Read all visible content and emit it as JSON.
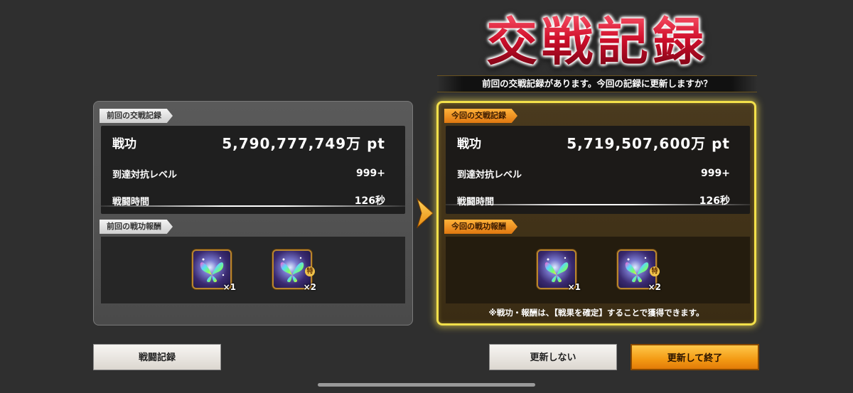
{
  "header": {
    "title": "交戦記録",
    "subtitle": "前回の交戦記録があります。今回の記録に更新しますか？"
  },
  "previous": {
    "record_label": "前回の交戦記録",
    "merit_label": "戦功",
    "merit_value": "5,790,777,749万 pt",
    "level_label": "到達対抗レベル",
    "level_value": "999+",
    "time_label": "戦闘時間",
    "time_value": "126秒",
    "reward_label": "前回の戦功報酬",
    "rewards": [
      {
        "icon": "rainbow-butterfly-icon",
        "qty": "×1",
        "special": ""
      },
      {
        "icon": "rainbow-butterfly-icon",
        "qty": "×2",
        "special": "特"
      }
    ]
  },
  "current": {
    "record_label": "今回の交戦記録",
    "merit_label": "戦功",
    "merit_value": "5,719,507,600万 pt",
    "level_label": "到達対抗レベル",
    "level_value": "999+",
    "time_label": "戦闘時間",
    "time_value": "126秒",
    "reward_label": "今回の戦功報酬",
    "rewards": [
      {
        "icon": "rainbow-butterfly-icon",
        "qty": "×1",
        "special": ""
      },
      {
        "icon": "rainbow-butterfly-icon",
        "qty": "×2",
        "special": "特"
      }
    ],
    "note": "※戦功・報酬は、【戦果を確定】することで獲得できます。"
  },
  "buttons": {
    "battle_log": "戦闘記録",
    "no_update": "更新しない",
    "update_finish": "更新して終了"
  },
  "colors": {
    "highlight_border": "#f3e04a",
    "gold_button": "#f39a14",
    "title_red": "#d0102c"
  }
}
